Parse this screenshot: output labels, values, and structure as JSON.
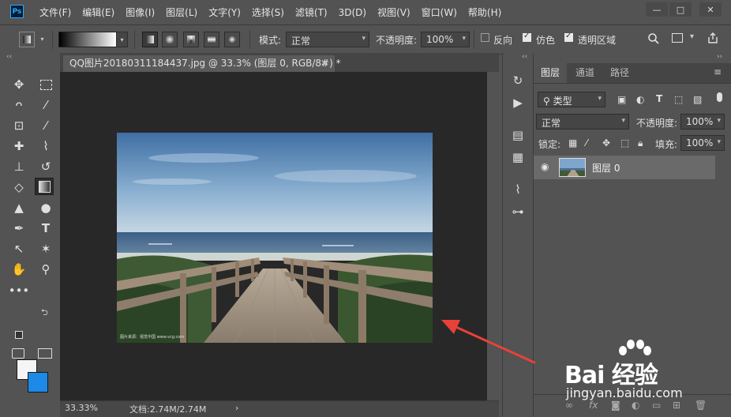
{
  "app": {
    "logo": "Ps",
    "window_controls": [
      "—",
      "□",
      "✕"
    ]
  },
  "menu": [
    "文件(F)",
    "编辑(E)",
    "图像(I)",
    "图层(L)",
    "文字(Y)",
    "选择(S)",
    "滤镜(T)",
    "3D(D)",
    "视图(V)",
    "窗口(W)",
    "帮助(H)"
  ],
  "options": {
    "mode_label": "模式:",
    "mode_value": "正常",
    "opacity_label": "不透明度:",
    "opacity_value": "100%",
    "reverse_label": "反向",
    "reverse_checked": false,
    "dither_label": "仿色",
    "dither_checked": true,
    "transparency_label": "透明区域",
    "transparency_checked": true
  },
  "document": {
    "tab_title": "QQ图片20180311184437.jpg @ 33.3% (图层 0, RGB/8#) *",
    "close_glyph": "✕",
    "watermark": "图片来源：视觉中国 www.vcg.com"
  },
  "status": {
    "zoom": "33.33%",
    "doc_info": "文档:2.74M/2.74M",
    "arrow": "›"
  },
  "layers_panel": {
    "tabs": [
      "图层",
      "通道",
      "路径"
    ],
    "active_tab": 0,
    "filter_label": "类型",
    "blend_mode": "正常",
    "opacity_label": "不透明度:",
    "opacity_value": "100%",
    "lock_label": "锁定:",
    "fill_label": "填充:",
    "fill_value": "100%",
    "layers": [
      {
        "name": "图层 0",
        "visible": true
      }
    ]
  },
  "colors": {
    "foreground": "#f5f5f5",
    "background": "#1c8ae6",
    "arrow": "#e8413a",
    "canvas_bg": "#282828",
    "ui_bg": "#535353"
  },
  "watermark_brand": {
    "text": "Bai 经验",
    "sub": "jingyan.baidu.com"
  }
}
